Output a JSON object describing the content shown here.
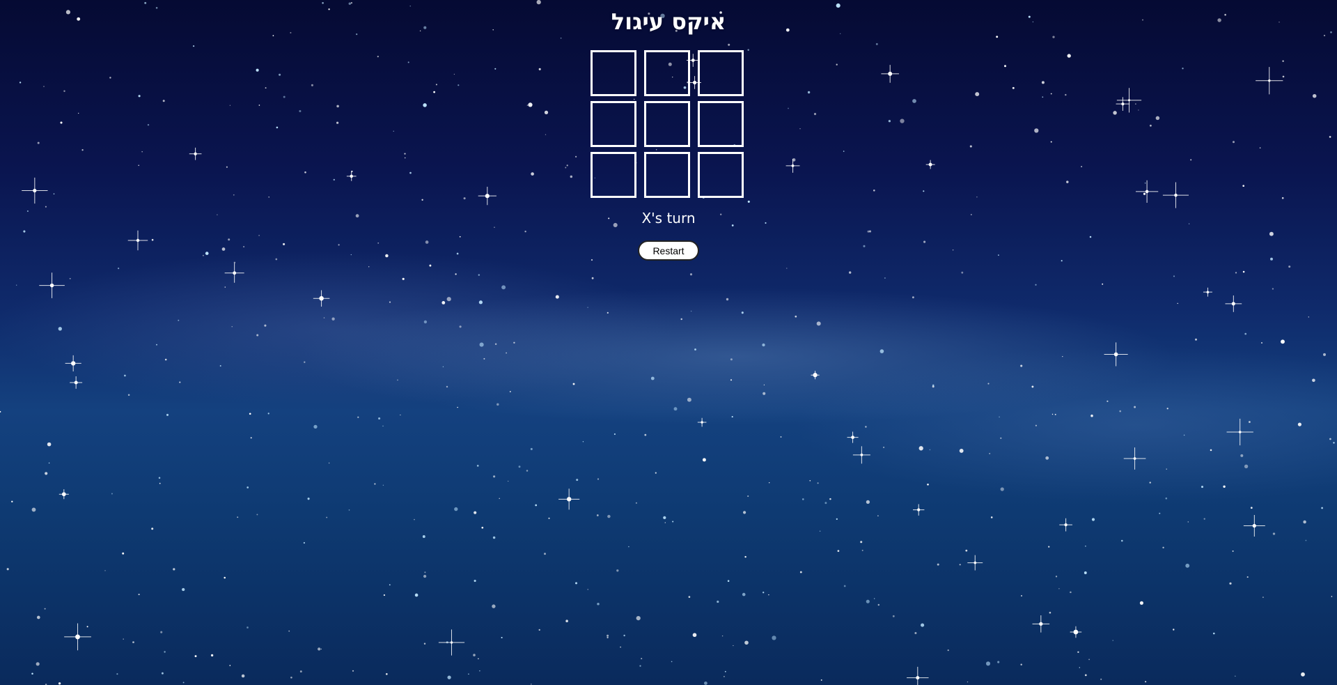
{
  "game": {
    "title": "איקס עיגול",
    "status": "X's turn",
    "restart_label": "Restart",
    "board": [
      "",
      "",
      "",
      "",
      "",
      "",
      "",
      "",
      ""
    ]
  },
  "theme": {
    "background": "starry-night-sky",
    "text_color": "#ffffff",
    "cell_border_color": "#ffffff",
    "button_background": "#ffffff",
    "button_text_color": "#000000"
  }
}
